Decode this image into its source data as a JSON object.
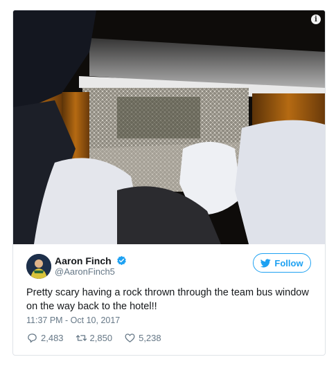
{
  "photo": {
    "alt_icon": "info-icon"
  },
  "author": {
    "name": "Aaron Finch",
    "handle": "@AaronFinch5",
    "verified": true
  },
  "follow": {
    "label": "Follow",
    "icon": "twitter-bird-icon",
    "color": "#1da1f2"
  },
  "tweet": {
    "text": "Pretty scary having a rock thrown through the team bus window on the way back to the hotel!!",
    "timestamp": "11:37 PM - Oct 10, 2017"
  },
  "actions": {
    "replies": "2,483",
    "retweets": "2,850",
    "likes": "5,238"
  },
  "colors": {
    "accent": "#1da1f2",
    "muted": "#657786",
    "text": "#14171a"
  }
}
